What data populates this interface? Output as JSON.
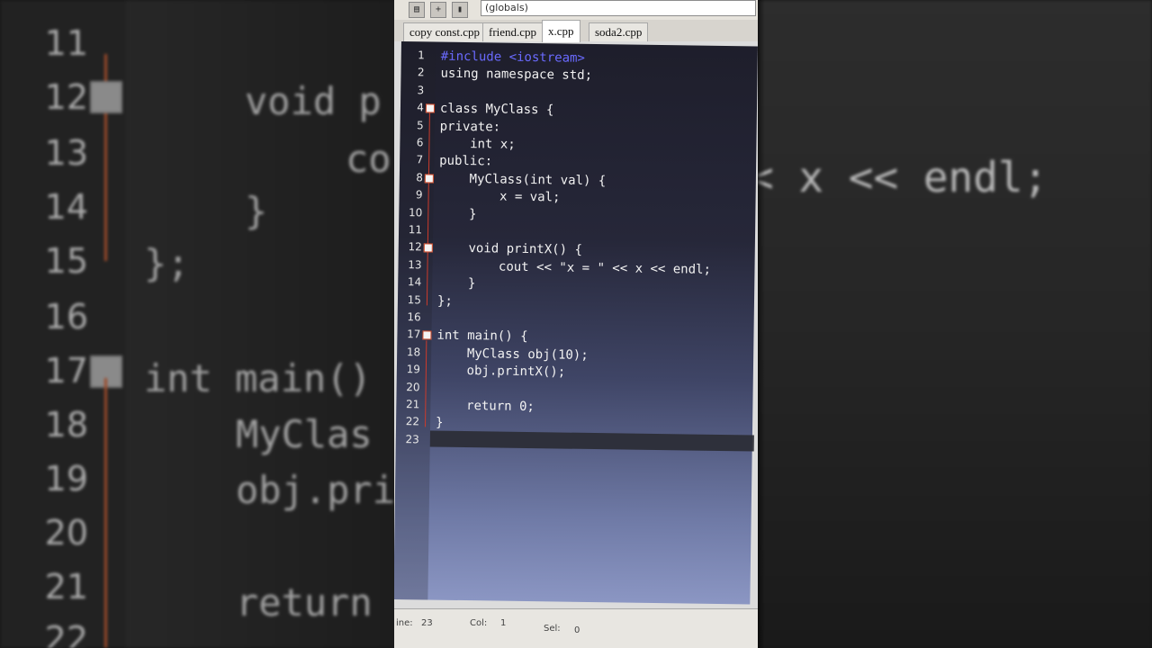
{
  "toolbar": {
    "scope_value": "(globals)",
    "buttons": [
      "new-file-icon",
      "add-icon",
      "save-icon"
    ]
  },
  "tabs": [
    {
      "label": "copy const.cpp",
      "active": false
    },
    {
      "label": "friend.cpp",
      "active": false
    },
    {
      "label": "x.cpp",
      "active": true
    },
    {
      "label": "soda2.cpp",
      "active": false
    }
  ],
  "code_lines": [
    {
      "n": "1",
      "text": "#include <iostream>"
    },
    {
      "n": "2",
      "text": "using namespace std;"
    },
    {
      "n": "3",
      "text": ""
    },
    {
      "n": "4",
      "text": "class MyClass {"
    },
    {
      "n": "5",
      "text": "private:"
    },
    {
      "n": "6",
      "text": "    int x;"
    },
    {
      "n": "7",
      "text": "public:"
    },
    {
      "n": "8",
      "text": "    MyClass(int val) {"
    },
    {
      "n": "9",
      "text": "        x = val;"
    },
    {
      "n": "10",
      "text": "    }"
    },
    {
      "n": "11",
      "text": ""
    },
    {
      "n": "12",
      "text": "    void printX() {"
    },
    {
      "n": "13",
      "text": "        cout << \"x = \" << x << endl;"
    },
    {
      "n": "14",
      "text": "    }"
    },
    {
      "n": "15",
      "text": "};"
    },
    {
      "n": "16",
      "text": ""
    },
    {
      "n": "17",
      "text": "int main() {"
    },
    {
      "n": "18",
      "text": "    MyClass obj(10);"
    },
    {
      "n": "19",
      "text": "    obj.printX();"
    },
    {
      "n": "20",
      "text": ""
    },
    {
      "n": "21",
      "text": "    return 0;"
    },
    {
      "n": "22",
      "text": "}"
    },
    {
      "n": "23",
      "text": ""
    }
  ],
  "status": {
    "line_label": "ine:",
    "line_value": "23",
    "col_label": "Col:",
    "col_value": "1",
    "sel_label": "Sel:",
    "sel_value": "0"
  },
  "background_zoom": {
    "line_numbers": [
      "11",
      "12",
      "13",
      "14",
      "15",
      "16",
      "17",
      "18",
      "19",
      "20",
      "21",
      "22"
    ],
    "code_left": [
      "void p",
      "co",
      "}",
      "};",
      "",
      "int main()",
      "MyClas",
      "obj.pri",
      "",
      "return"
    ],
    "code_right": "< x << endl;"
  },
  "colors": {
    "editor_top": "#1e1e2b",
    "editor_bottom": "#8b96c3",
    "fold_marker": "#cc3b2b",
    "keyword": "#f2f2f2",
    "type_name": "#8fb4ff",
    "preprocessor": "#6a6aff",
    "string": "#ffd86b",
    "number": "#ffb86b"
  }
}
